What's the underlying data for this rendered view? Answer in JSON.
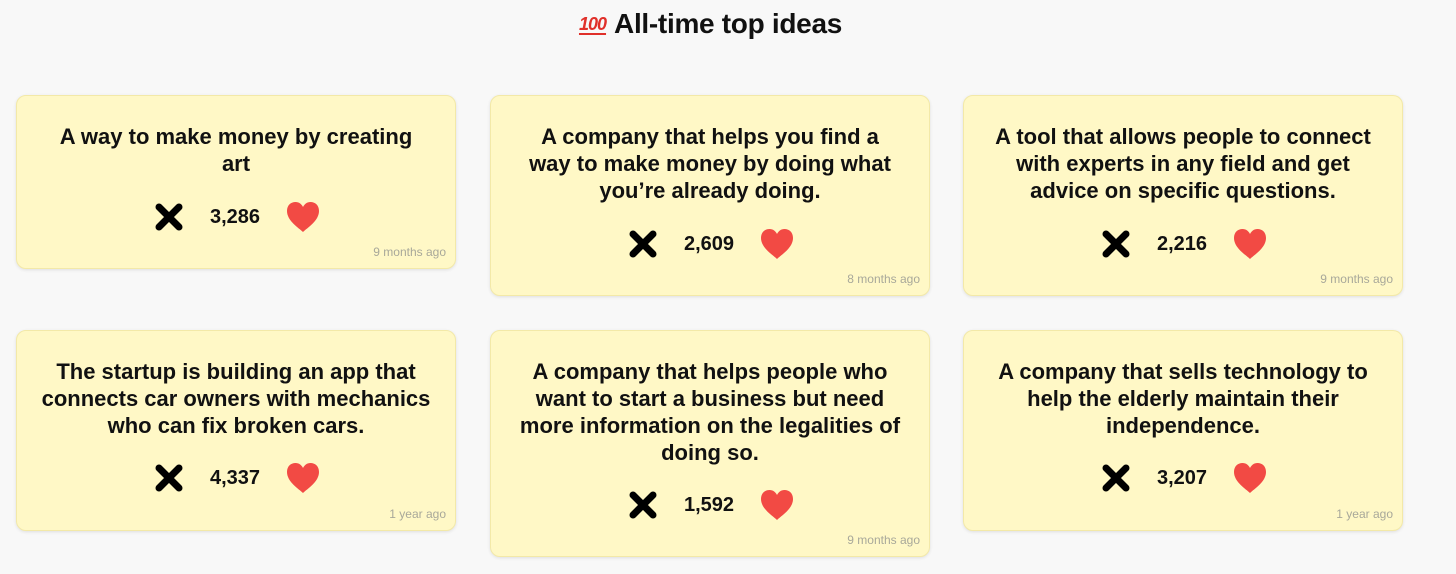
{
  "header": {
    "icon": "hundred-points-icon",
    "icon_text": "100",
    "title": "All-time top ideas"
  },
  "colors": {
    "card_background": "#fff8c6",
    "heart": "#f24a44",
    "cross": "#000000",
    "timestamp": "#a8a89a"
  },
  "ideas": [
    {
      "text": "A way to make money by creating art",
      "count": "3,286",
      "time": "9 months ago"
    },
    {
      "text": "A company that helps you find a way to make money by doing what you’re already doing.",
      "count": "2,609",
      "time": "8 months ago"
    },
    {
      "text": "A tool that allows people to connect with experts in any field and get advice on specific questions.",
      "count": "2,216",
      "time": "9 months ago"
    },
    {
      "text": "The startup is building an app that connects car owners with mechanics who can fix broken cars.",
      "count": "4,337",
      "time": "1 year ago"
    },
    {
      "text": "A company that helps people who want to start a business but need more information on the legalities of doing so.",
      "count": "1,592",
      "time": "9 months ago"
    },
    {
      "text": "A company that sells technology to help the elderly maintain their independence.",
      "count": "3,207",
      "time": "1 year ago"
    }
  ]
}
